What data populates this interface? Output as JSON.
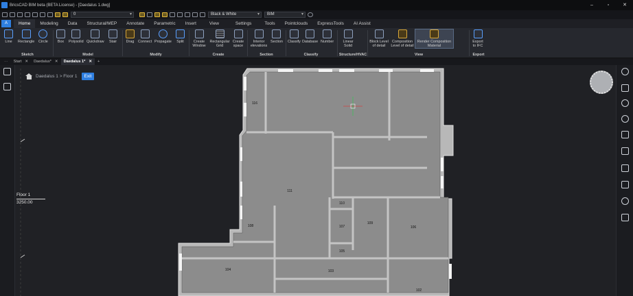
{
  "window": {
    "title": "BricsCAD BIM beta (BETA License) - [Daedalus 1.dwg]",
    "controls": [
      "–",
      "▫",
      "✕"
    ]
  },
  "toolbar": {
    "layer_value": "0",
    "visual_style": "Black & White",
    "workspace": "BIM"
  },
  "menu": {
    "app_button": "A",
    "tabs": [
      "Home",
      "Modeling",
      "Data",
      "Structural/MEP",
      "Annotate",
      "Parametric",
      "Insert",
      "View",
      "Settings",
      "Tools",
      "Pointclouds",
      "ExpressTools",
      "AI Assist"
    ],
    "active_tab": "Home"
  },
  "ribbon": {
    "buttons": [
      {
        "label": "Line"
      },
      {
        "label": "Rectangle"
      },
      {
        "label": "Circle"
      },
      {
        "label": "Box"
      },
      {
        "label": "Polysolid"
      },
      {
        "label": "Quickdraw"
      },
      {
        "label": "Stair"
      },
      {
        "label": "Drag"
      },
      {
        "label": "Connect"
      },
      {
        "label": "Propagate"
      },
      {
        "label": "Split"
      },
      {
        "label": "Create Window"
      },
      {
        "label": "Rectangular Grid"
      },
      {
        "label": "Create space"
      },
      {
        "label": "Interior elevations"
      },
      {
        "label": "Section"
      },
      {
        "label": "Classify"
      },
      {
        "label": "Database"
      },
      {
        "label": "Number"
      },
      {
        "label": "Linear Solid"
      },
      {
        "label": "Block Level of detail"
      },
      {
        "label": "Composition Level of detail"
      },
      {
        "label": "Render Composition Material"
      },
      {
        "label": "Export to IFC"
      }
    ],
    "groups": [
      "Sketch",
      "Model",
      "Modify",
      "Create",
      "Section",
      "Classify",
      "Structure/HVAC",
      "View",
      "Export"
    ]
  },
  "doc_tabs": [
    "Start",
    "Daedalus*",
    "Daedalus 1*"
  ],
  "doc_tabs_active": "Daedalus 1*",
  "breadcrumb": {
    "path": "Daedalus 1 > Floor 1",
    "exit": "Exit"
  },
  "level_marker": {
    "name": "Floor 1",
    "elevation": "3250.00"
  },
  "rooms": [
    "116",
    "111",
    "110",
    "109",
    "107",
    "108",
    "105",
    "106",
    "104",
    "103",
    "102"
  ],
  "colors": {
    "accent": "#2f7fe0",
    "room_fill": "#8c8c8c",
    "canvas": "#202125"
  }
}
